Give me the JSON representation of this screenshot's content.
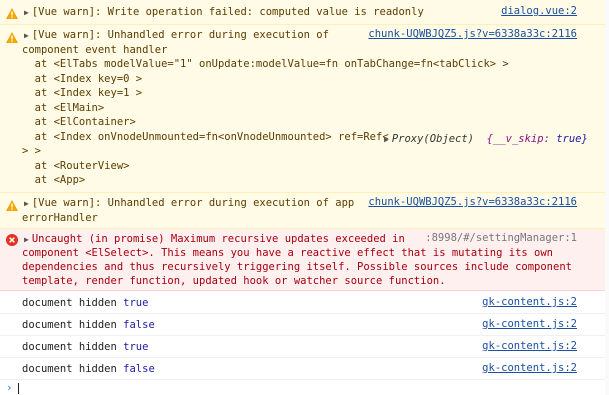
{
  "messages": {
    "m1": {
      "text": "[Vue warn]: Write operation failed: computed value is readonly",
      "source": "dialog.vue:2"
    },
    "m2": {
      "line1": "[Vue warn]: Unhandled error during execution of",
      "line2": "component event handler",
      "source": "chunk-UQWBJQZ5.js?v=6338a33c:2116",
      "trace": [
        "  at <ElTabs modelValue=\"1\" onUpdate:modelValue=fn onTabChange=fn<tabClick> >",
        "  at <Index key=0 >",
        "  at <Index key=1 >",
        "  at <ElMain>",
        "  at <ElContainer>",
        "  at <Index onVnodeUnmounted=fn<onVnodeUnmounted> ref=Ref<",
        "> >",
        "  at <RouterView>",
        "  at <App>"
      ],
      "proxy_label": "Proxy(Object)",
      "skip_key": "{__v_skip:",
      "skip_value": "true}"
    },
    "m3": {
      "line1": "[Vue warn]: Unhandled error during execution of app",
      "line2": "errorHandler",
      "source": "chunk-UQWBJQZ5.js?v=6338a33c:2116"
    },
    "m4": {
      "lines": [
        "Uncaught (in promise) Maximum recursive updates exceeded in",
        "component <ElSelect>. This means you have a reactive effect that is mutating its own",
        "dependencies and thus recursively triggering itself. Possible sources include component",
        "template, render function, updated hook or watcher source function."
      ],
      "source": ":8998/#/settingManager:1"
    },
    "logs": [
      {
        "label": "document hidden",
        "value": "true",
        "source": "gk-content.js:2"
      },
      {
        "label": "document hidden",
        "value": "false",
        "source": "gk-content.js:2"
      },
      {
        "label": "document hidden",
        "value": "true",
        "source": "gk-content.js:2"
      },
      {
        "label": "document hidden",
        "value": "false",
        "source": "gk-content.js:2"
      }
    ]
  },
  "icons": {
    "warning": "warning-icon",
    "error": "error-icon",
    "expand": "expand-triangle-icon",
    "prompt": "prompt-chevron-icon"
  },
  "colors": {
    "warn_bg": "#fffbe6",
    "error_bg": "#fff0f0",
    "link": "#1a4fa3",
    "boolean": "#1a1aa6"
  }
}
